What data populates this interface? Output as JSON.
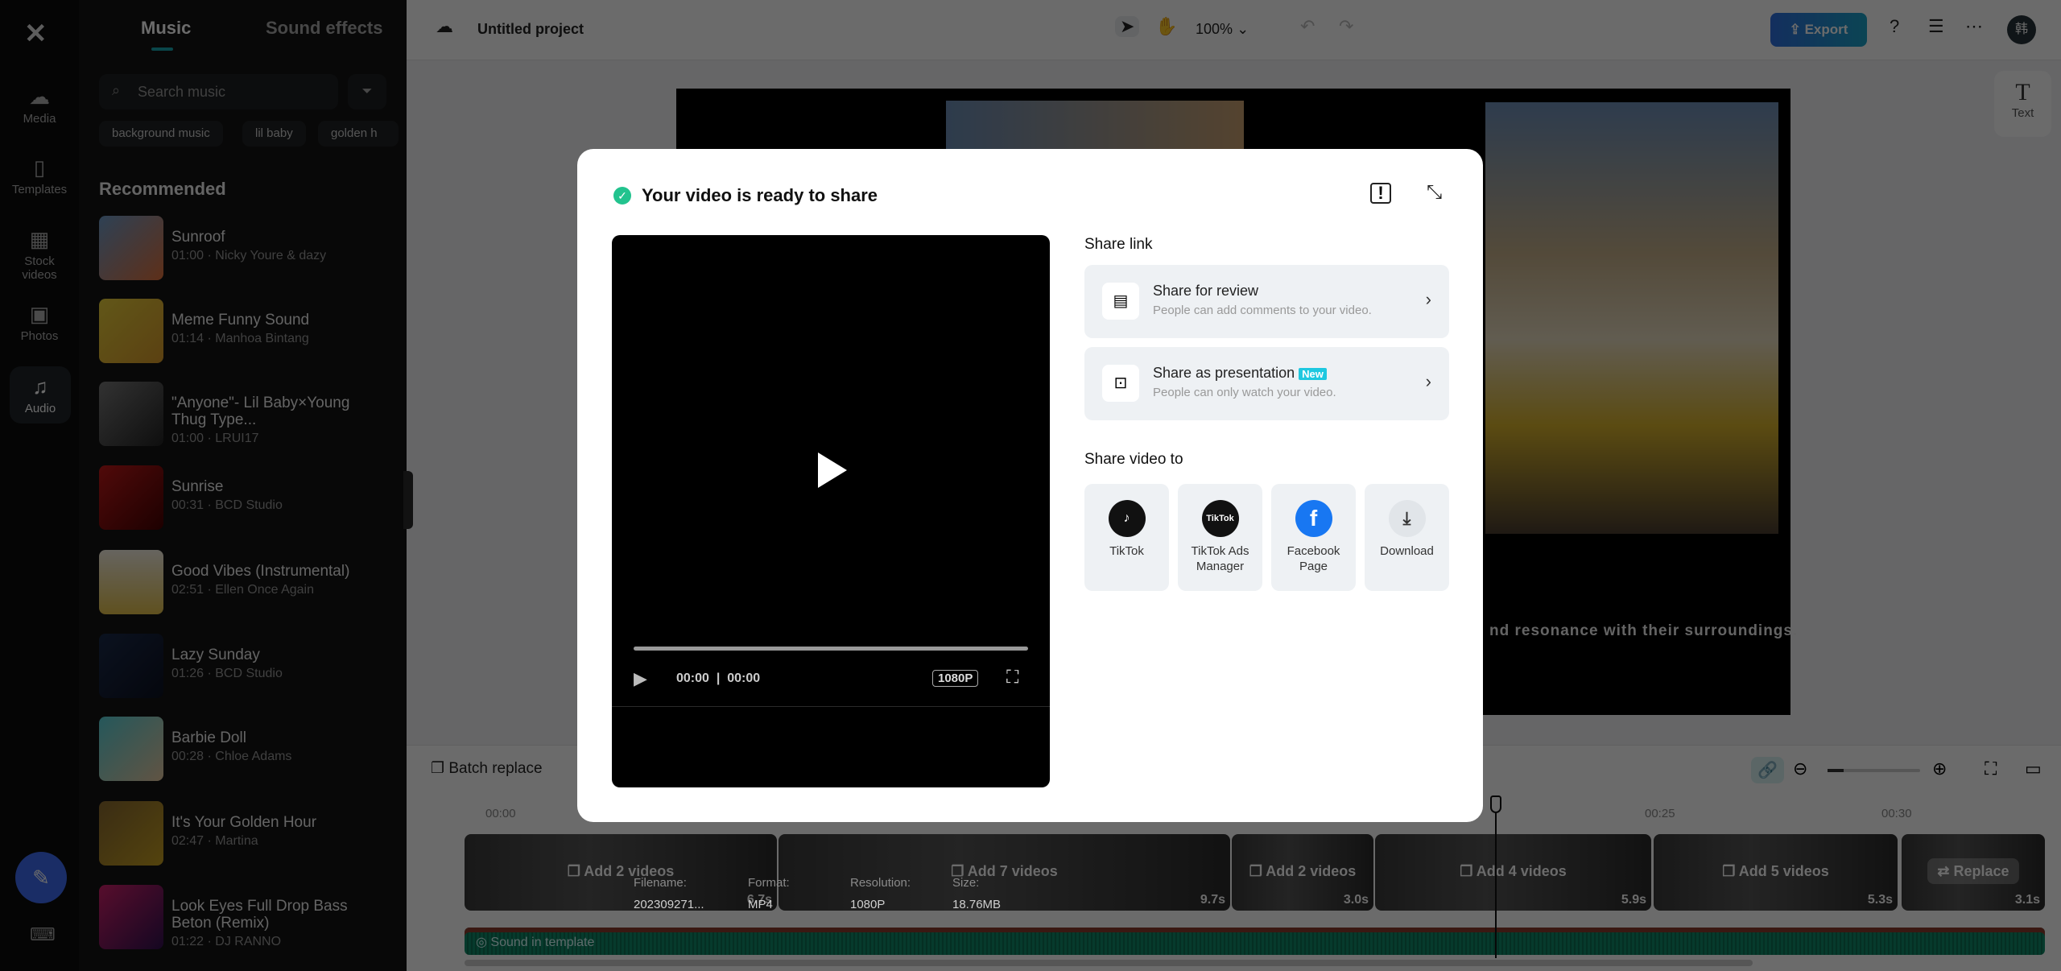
{
  "app": {
    "project_title": "Untitled project",
    "zoom": "100%",
    "export_label": "Export",
    "avatar": "韩",
    "accent": "#1f6fd1"
  },
  "rail": {
    "items": [
      {
        "label": "Media",
        "icon": "cloud-upload-icon"
      },
      {
        "label": "Templates",
        "icon": "template-icon"
      },
      {
        "label": "Stock videos",
        "icon": "film-icon"
      },
      {
        "label": "Photos",
        "icon": "image-icon"
      },
      {
        "label": "Audio",
        "icon": "music-icon",
        "active": true
      }
    ]
  },
  "panel": {
    "tabs": [
      "Music",
      "Sound effects"
    ],
    "active_tab": "Music",
    "search_placeholder": "Search music",
    "chips": [
      "background music",
      "lil baby",
      "golden h"
    ],
    "section": "Recommended",
    "songs": [
      {
        "title": "Sunroof",
        "meta": "01:00 · Nicky Youre & dazy"
      },
      {
        "title": "Meme Funny Sound",
        "meta": "01:14 · Manhoa Bintang"
      },
      {
        "title": "\"Anyone\"- Lil Baby×Young Thug Type...",
        "meta": "01:00 · LRUI17"
      },
      {
        "title": "Sunrise",
        "meta": "00:31 · BCD Studio"
      },
      {
        "title": "Good Vibes (Instrumental)",
        "meta": "02:51 · Ellen Once Again"
      },
      {
        "title": "Lazy Sunday",
        "meta": "01:26 · BCD Studio"
      },
      {
        "title": "Barbie Doll",
        "meta": "00:28 · Chloe Adams"
      },
      {
        "title": "It's Your Golden Hour",
        "meta": "02:47 · Martina"
      },
      {
        "title": "Look Eyes Full Drop Bass Beton (Remix)",
        "meta": "01:22 · DJ RANNO"
      }
    ]
  },
  "right_panel": {
    "text_label": "Text"
  },
  "canvas": {
    "caption": "nd resonance with their surroundings."
  },
  "timeline": {
    "batch_replace": "Batch replace",
    "ruler": [
      "00:00",
      "00:25",
      "00:30"
    ],
    "clips": [
      {
        "label": "Add 2 videos",
        "dur": "6.7s"
      },
      {
        "label": "Add 7 videos",
        "dur": "9.7s"
      },
      {
        "label": "Add 2 videos",
        "dur": "3.0s"
      },
      {
        "label": "Add 4 videos",
        "dur": "5.9s"
      },
      {
        "label": "Add 5 videos",
        "dur": "5.3s"
      },
      {
        "label": "Replace",
        "dur": "3.1s"
      }
    ],
    "audio_label": "Sound in template"
  },
  "modal": {
    "title": "Your video is ready to share",
    "share_link": "Share link",
    "review": {
      "title": "Share for review",
      "sub": "People can add comments to your video."
    },
    "presentation": {
      "title": "Share as presentation",
      "badge": "New",
      "sub": "People can only watch your video."
    },
    "share_to": "Share video to",
    "targets": [
      {
        "label": "TikTok"
      },
      {
        "label": "TikTok Ads Manager"
      },
      {
        "label": "Facebook Page"
      },
      {
        "label": "Download"
      }
    ],
    "player": {
      "current": "00:00",
      "total": "00:00",
      "quality": "1080P"
    },
    "info": {
      "filename_label": "Filename:",
      "filename": "202309271...",
      "format_label": "Format:",
      "format": "MP4",
      "resolution_label": "Resolution:",
      "resolution": "1080P",
      "size_label": "Size:",
      "size": "18.76MB"
    }
  }
}
